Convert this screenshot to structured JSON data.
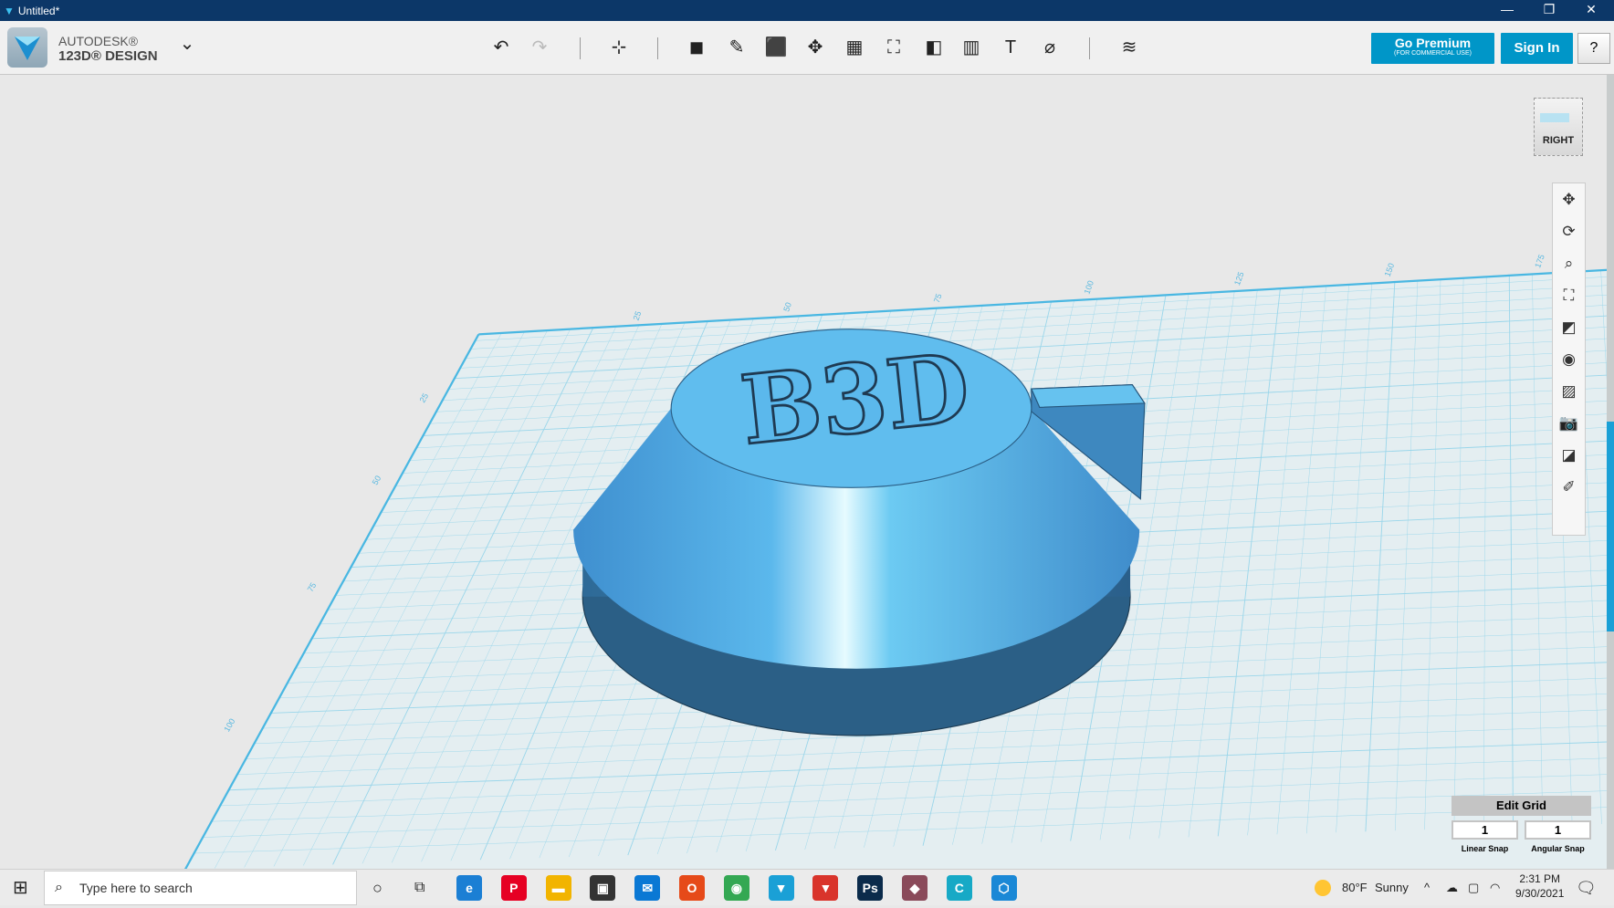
{
  "window": {
    "title": "Untitled*",
    "minimize": "—",
    "restore": "❐",
    "close": "✕"
  },
  "brand": {
    "line1": "AUTODESK®",
    "line2": "123D® DESIGN",
    "menu_chevron": "⌄"
  },
  "toolbar": {
    "tools": [
      {
        "name": "undo",
        "glyph": "↶"
      },
      {
        "name": "redo",
        "glyph": "↷"
      },
      {
        "name": "transform",
        "glyph": "⊹"
      },
      {
        "name": "primitives",
        "glyph": "◼"
      },
      {
        "name": "sketch",
        "glyph": "✎"
      },
      {
        "name": "construct",
        "glyph": "⬛"
      },
      {
        "name": "modify",
        "glyph": "✥"
      },
      {
        "name": "pattern",
        "glyph": "▦"
      },
      {
        "name": "grouping",
        "glyph": "⛶"
      },
      {
        "name": "combine",
        "glyph": "◧"
      },
      {
        "name": "measure",
        "glyph": "▥"
      },
      {
        "name": "text",
        "glyph": "T"
      },
      {
        "name": "snap",
        "glyph": "⌀"
      },
      {
        "name": "materials",
        "glyph": "≋"
      }
    ],
    "go_premium": "Go Premium",
    "go_premium_sub": "(FOR COMMERCIAL USE)",
    "sign_in": "Sign In",
    "help": "?"
  },
  "viewcube": {
    "face": "RIGHT"
  },
  "nav": [
    {
      "name": "pan",
      "glyph": "✥"
    },
    {
      "name": "orbit",
      "glyph": "⟳"
    },
    {
      "name": "zoom",
      "glyph": "⌕"
    },
    {
      "name": "fit",
      "glyph": "⛶"
    },
    {
      "name": "views",
      "glyph": "◩"
    },
    {
      "name": "visibility",
      "glyph": "◉"
    },
    {
      "name": "materials",
      "glyph": "▨"
    },
    {
      "name": "camera",
      "glyph": "📷"
    },
    {
      "name": "hide-selected",
      "glyph": "◪"
    },
    {
      "name": "show-all",
      "glyph": "✐"
    }
  ],
  "model": {
    "text": "B3D",
    "color": "#5bb8ec"
  },
  "ruler": {
    "top": [
      "25",
      "50",
      "75",
      "100",
      "125",
      "150",
      "175"
    ],
    "left": [
      "25",
      "50",
      "75",
      "100"
    ]
  },
  "edit_grid": {
    "title": "Edit Grid",
    "linear_value": "1",
    "angular_value": "1",
    "linear_label": "Linear Snap",
    "angular_label": "Angular Snap"
  },
  "taskbar": {
    "start": "⊞",
    "search_placeholder": "Type here to search",
    "cortana": "○",
    "task_view": "⧉",
    "apps": [
      {
        "name": "edge",
        "glyph": "e",
        "color": "#1b7fd4"
      },
      {
        "name": "pinterest",
        "glyph": "P",
        "color": "#e60023"
      },
      {
        "name": "file-explorer",
        "glyph": "▬",
        "color": "#f2b400"
      },
      {
        "name": "store",
        "glyph": "▣",
        "color": "#333"
      },
      {
        "name": "mail",
        "glyph": "✉",
        "color": "#0a78d4"
      },
      {
        "name": "office",
        "glyph": "O",
        "color": "#e64a19"
      },
      {
        "name": "chrome",
        "glyph": "◉",
        "color": "#34a853"
      },
      {
        "name": "123d-design",
        "glyph": "▼",
        "color": "#1aa0d6"
      },
      {
        "name": "app-red",
        "glyph": "▼",
        "color": "#d9342b"
      },
      {
        "name": "photoshop",
        "glyph": "Ps",
        "color": "#0b2b4b"
      },
      {
        "name": "meshmixer",
        "glyph": "◆",
        "color": "#8a4a5a"
      },
      {
        "name": "app-c",
        "glyph": "C",
        "color": "#17a9c6"
      },
      {
        "name": "app-cube",
        "glyph": "⬡",
        "color": "#1a88d6"
      }
    ],
    "weather_temp": "80°F",
    "weather_desc": "Sunny",
    "time": "2:31 PM",
    "date": "9/30/2021",
    "notif": "🗨"
  }
}
